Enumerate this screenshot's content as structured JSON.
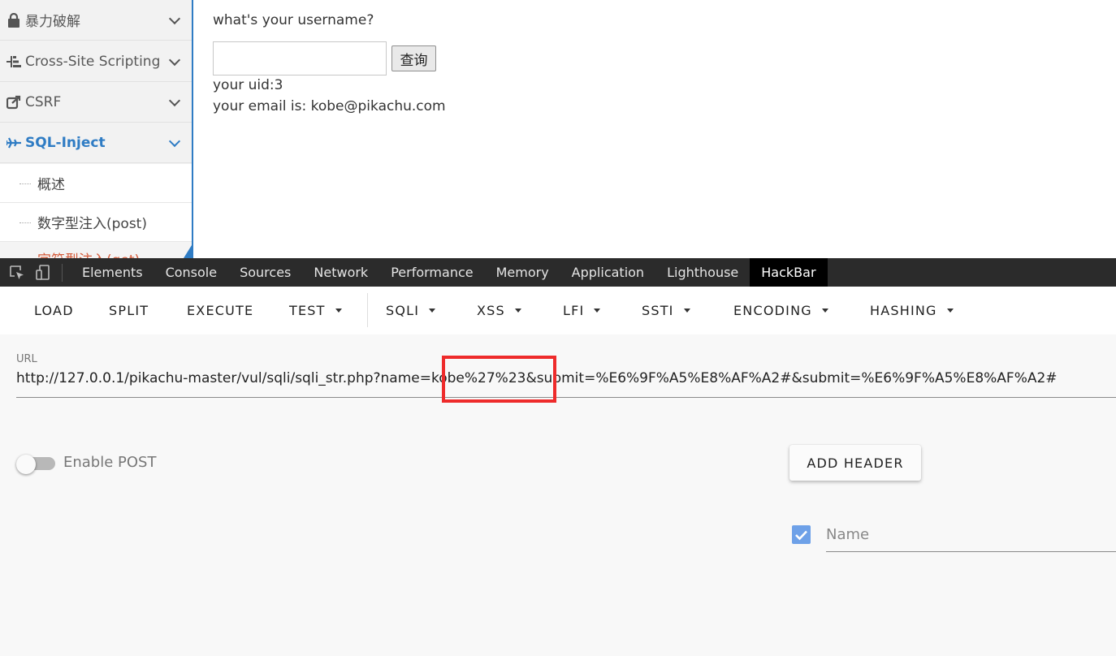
{
  "sidebar": {
    "items": [
      {
        "label": "暴力破解",
        "icon": "lock-icon"
      },
      {
        "label": "Cross-Site Scripting",
        "icon": "sitemap-icon"
      },
      {
        "label": "CSRF",
        "icon": "share-square-icon"
      },
      {
        "label": "SQL-Inject",
        "icon": "plane-icon"
      }
    ],
    "subitems": [
      {
        "label": "概述"
      },
      {
        "label": "数字型注入(post)"
      },
      {
        "label": "字符型注入(get)"
      }
    ]
  },
  "main": {
    "question": "what's your username?",
    "input_value": "",
    "button_label": "查询",
    "uid_line": "your uid:3",
    "email_line": "your email is: kobe@pikachu.com"
  },
  "devtools": {
    "tabs": [
      "Elements",
      "Console",
      "Sources",
      "Network",
      "Performance",
      "Memory",
      "Application",
      "Lighthouse",
      "HackBar"
    ],
    "active_tab": "HackBar"
  },
  "hackbar": {
    "toolbar": {
      "load": "LOAD",
      "split": "SPLIT",
      "execute": "EXECUTE",
      "test": "TEST",
      "sqli": "SQLI",
      "xss": "XSS",
      "lfi": "LFI",
      "ssti": "SSTI",
      "encoding": "ENCODING",
      "hashing": "HASHING"
    },
    "url_label": "URL",
    "url_value": "http://127.0.0.1/pikachu-master/vul/sqli/sqli_str.php?name=kobe%27%23&submit=%E6%9F%A5%E8%AF%A2#&submit=%E6%9F%A5%E8%AF%A2#",
    "enable_post_label": "Enable POST",
    "enable_post_on": false,
    "add_header_label": "ADD HEADER",
    "header_name_placeholder": "Name",
    "header_checked": true
  },
  "colors": {
    "accent_blue": "#2f7cc4",
    "highlight_red": "#ee2b2b",
    "devtools_bg": "#2b2b2b",
    "checkbox_blue": "#6ea1e8"
  }
}
